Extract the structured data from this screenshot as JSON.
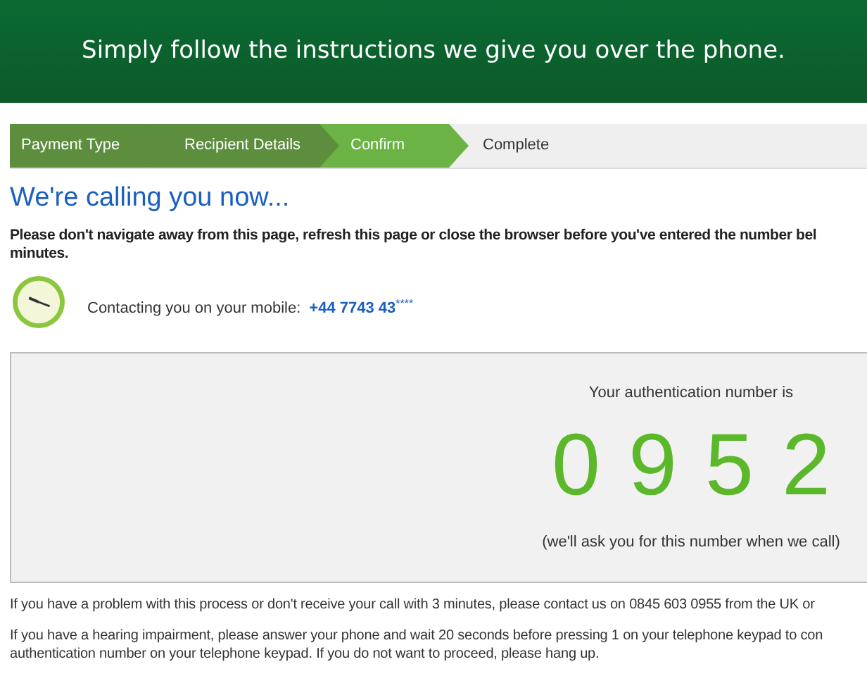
{
  "banner": {
    "text": "Simply follow the instructions we give you over the phone."
  },
  "steps": [
    {
      "label": "Payment Type",
      "completed": true,
      "selected": false
    },
    {
      "label": "Recipient Details",
      "completed": true,
      "selected": false
    },
    {
      "label": "Confirm",
      "completed": false,
      "selected": true
    },
    {
      "label": "Complete",
      "completed": false,
      "selected": false
    }
  ],
  "heading": "We're calling you now...",
  "warning": [
    "Please don't navigate away from this page, refresh this page or close the browser before you've entered the number bel",
    "minutes."
  ],
  "contact": {
    "label": "Contacting you on your mobile:",
    "number": "+44 7743 43",
    "masked": "****"
  },
  "auth": {
    "label": "Your authentication number is",
    "digits": [
      "0",
      "9",
      "5",
      "2"
    ],
    "note": "(we'll ask you for this number when we call)"
  },
  "footer": [
    "If you have a problem with this process or don't receive your call with 3 minutes, please contact us on 0845 603 0955 from the UK or",
    "If you have a hearing impairment, please answer your phone and wait 20 seconds before pressing 1 on your telephone keypad to con",
    "authentication number on your telephone keypad. If you do not want to proceed, please hang up."
  ]
}
